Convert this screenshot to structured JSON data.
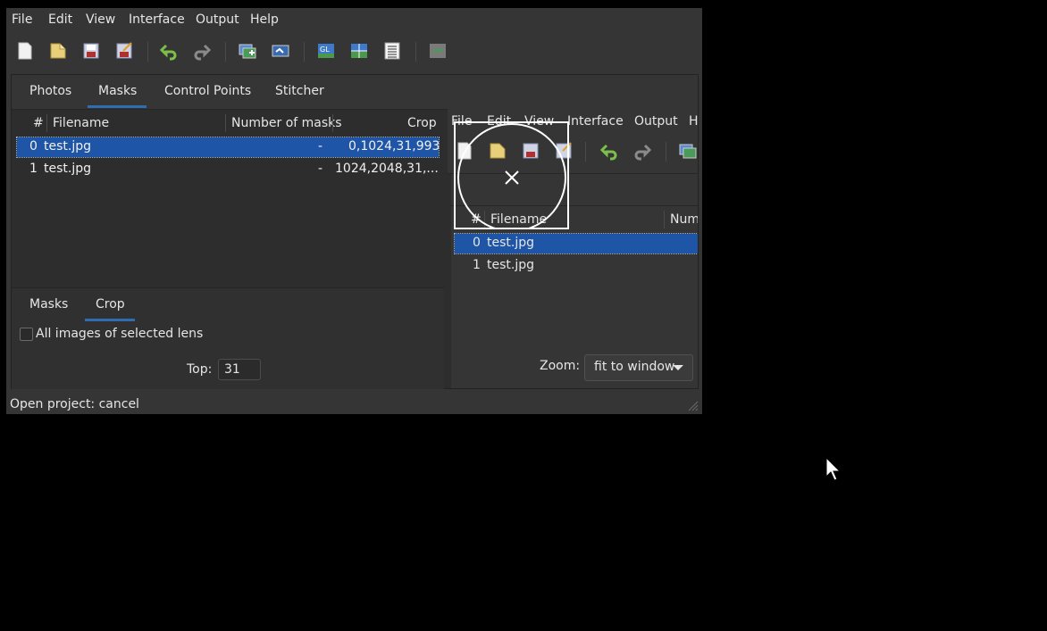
{
  "menubar": {
    "items": [
      "File",
      "Edit",
      "View",
      "Interface",
      "Output",
      "Help"
    ]
  },
  "toolbar": {
    "icons": [
      "new-project-icon",
      "open-project-icon",
      "save-icon",
      "save-as-icon",
      "undo-icon",
      "redo-icon",
      "add-images-icon",
      "align-icon",
      "gl-preview-icon",
      "fast-preview-icon",
      "list-icon",
      "stitch-icon"
    ]
  },
  "tabs": {
    "photos": "Photos",
    "masks": "Masks",
    "control_points": "Control Points",
    "stitcher": "Stitcher"
  },
  "table": {
    "headers": {
      "num": "#",
      "filename": "Filename",
      "masks": "Number of masks",
      "crop": "Crop"
    },
    "rows": [
      {
        "num": "0",
        "filename": "test.jpg",
        "masks": "-",
        "crop": "0,1024,31,993"
      },
      {
        "num": "1",
        "filename": "test.jpg",
        "masks": "-",
        "crop": "1024,2048,31,..."
      }
    ]
  },
  "bottom_tabs": {
    "masks": "Masks",
    "crop": "Crop"
  },
  "crop": {
    "all_images_label": "All images of selected lens",
    "top_label": "Top:",
    "top_value": "31"
  },
  "preview": {
    "menu": [
      "File",
      "Edit",
      "View",
      "Interface",
      "Output",
      "H"
    ],
    "headers": {
      "num": "#",
      "filename": "Filename",
      "masks": "Num"
    },
    "rows": [
      {
        "num": "0",
        "filename": "test.jpg"
      },
      {
        "num": "1",
        "filename": "test.jpg"
      }
    ],
    "zoom_label": "Zoom:",
    "zoom_value": "fit to window"
  },
  "status": {
    "text": "Open project: cancel"
  },
  "colors": {
    "selection": "#1f55a6",
    "accent": "#2f6cb0",
    "background": "#353535"
  }
}
